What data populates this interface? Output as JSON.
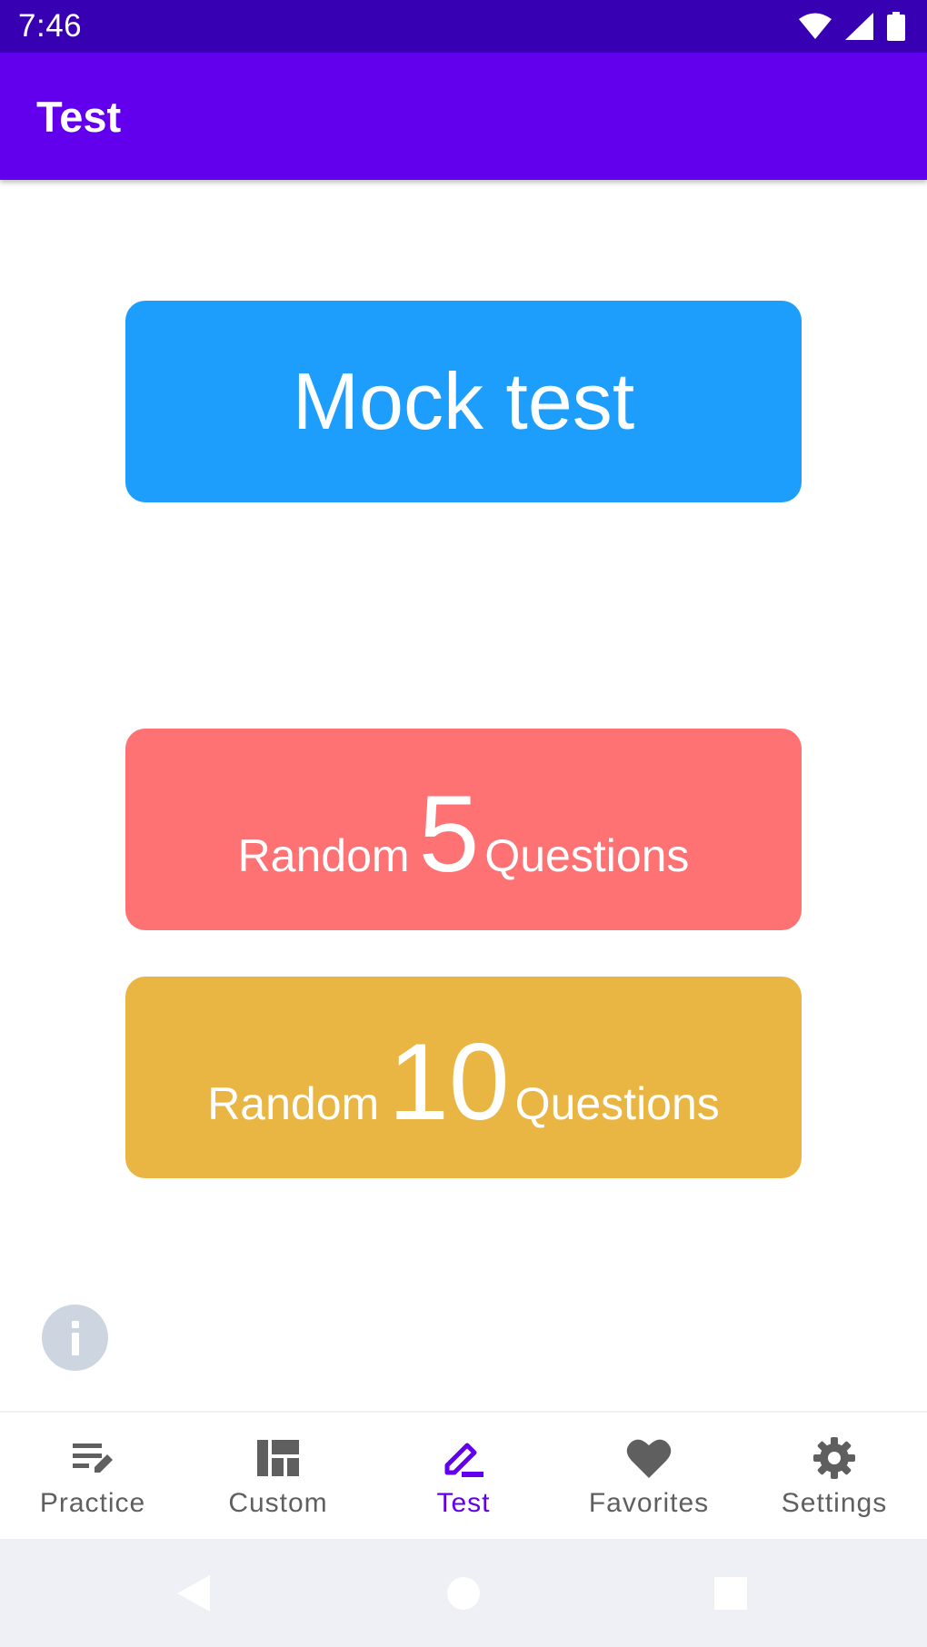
{
  "status_bar": {
    "time": "7:46",
    "icons": [
      "wifi-icon",
      "cell-signal-icon",
      "battery-icon"
    ]
  },
  "app_bar": {
    "title": "Test"
  },
  "buttons": {
    "mock_test": {
      "label": "Mock test",
      "color": "#1e9efc"
    },
    "random_5": {
      "prefix": "Random",
      "number": "5",
      "suffix": "Questions",
      "color": "#fe7274"
    },
    "random_10": {
      "prefix": "Random",
      "number": "10",
      "suffix": "Questions",
      "color": "#e9b543"
    }
  },
  "info": {
    "icon": "info-icon"
  },
  "bottom_nav": {
    "items": [
      {
        "label": "Practice",
        "icon": "practice-icon",
        "active": false
      },
      {
        "label": "Custom",
        "icon": "dashboard-icon",
        "active": false
      },
      {
        "label": "Test",
        "icon": "pen-icon",
        "active": true
      },
      {
        "label": "Favorites",
        "icon": "heart-icon",
        "active": false
      },
      {
        "label": "Settings",
        "icon": "gear-icon",
        "active": false
      }
    ],
    "active_color": "#6200ee",
    "inactive_color": "#5f5f5f"
  },
  "system_nav": {
    "icons": [
      "back-icon",
      "home-icon",
      "recents-icon"
    ]
  },
  "colors": {
    "status_bar": "#3700b3",
    "app_bar": "#6200ee"
  }
}
